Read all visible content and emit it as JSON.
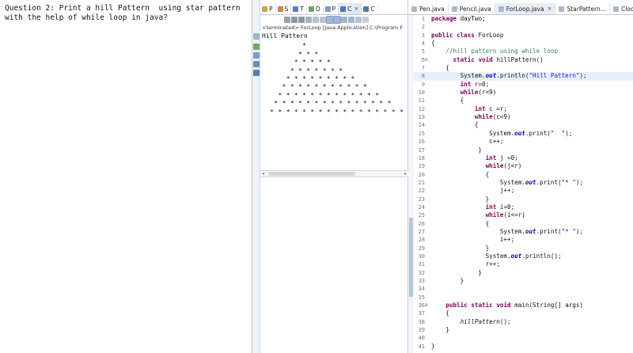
{
  "question": {
    "lines": [
      "Question 2: Print a hill Pattern  using star pattern",
      "with the help of while loop in java?"
    ]
  },
  "console": {
    "tabs": [
      {
        "label": "P",
        "icon": "problems-icon"
      },
      {
        "label": "S",
        "icon": "search-icon"
      },
      {
        "label": "T",
        "icon": "tasks-icon"
      },
      {
        "label": "D",
        "icon": "declaration-icon"
      },
      {
        "label": "P",
        "icon": "progress-icon"
      },
      {
        "label": "C",
        "icon": "console-icon",
        "active": true,
        "close": "×"
      },
      {
        "label": "C",
        "icon": "coverage-icon"
      }
    ],
    "status": "<terminated> ForLoop [Java Application] C:\\Program F",
    "output_title": "Hill Pattern",
    "output_rows": [
      "          * ",
      "         * * * ",
      "        * * * * * ",
      "       * * * * * * * ",
      "      * * * * * * * * * ",
      "     * * * * * * * * * * * ",
      "    * * * * * * * * * * * * * ",
      "   * * * * * * * * * * * * * * * ",
      "  * * * * * * * * * * * * * * * * * "
    ],
    "hscroll_left": "◂",
    "hscroll_right": "▸"
  },
  "editor": {
    "tabs": [
      {
        "label": "Pen.java"
      },
      {
        "label": "Pencil.java"
      },
      {
        "label": "ForLoop.java",
        "active": true,
        "close": "×"
      },
      {
        "label": "StarPattern..."
      },
      {
        "label": "Clock.ja"
      }
    ],
    "code_lines": [
      {
        "n": "1",
        "fold": "",
        "html": "<span class=\"kw\">package</span> dayTwo;"
      },
      {
        "n": "2",
        "fold": "",
        "html": ""
      },
      {
        "n": "3",
        "fold": "",
        "html": "<span class=\"kw\">public</span> <span class=\"kw\">class</span> ForLoop"
      },
      {
        "n": "4",
        "fold": "",
        "html": "{"
      },
      {
        "n": "5",
        "fold": "",
        "html": "    <span class=\"cm\">//hill pattern using while loop</span>"
      },
      {
        "n": "6",
        "fold": "⊖",
        "html": "      <span class=\"kw\">static</span> <span class=\"kw\">void</span> hillPattern()"
      },
      {
        "n": "7",
        "fold": "",
        "html": "    {"
      },
      {
        "n": "8",
        "fold": "",
        "html": "        System.<span class=\"fd\">out</span>.println(<span class=\"st\">\"Hill Pattern\"</span>);",
        "cur": true
      },
      {
        "n": "9",
        "fold": "",
        "html": "        <span class=\"kw\">int</span> r=0;"
      },
      {
        "n": "10",
        "fold": "",
        "html": "        <span class=\"kw\">while</span>(r&lt;9)"
      },
      {
        "n": "11",
        "fold": "",
        "html": "        {"
      },
      {
        "n": "12",
        "fold": "",
        "html": "            <span class=\"kw\">int</span> c =r;"
      },
      {
        "n": "13",
        "fold": "",
        "html": "            <span class=\"kw\">while</span>(c&lt;9)"
      },
      {
        "n": "14",
        "fold": "",
        "html": "            {"
      },
      {
        "n": "15",
        "fold": "",
        "html": "                System.<span class=\"fd\">out</span>.print(<span class=\"st\">\"  \"</span>);"
      },
      {
        "n": "16",
        "fold": "",
        "html": "                c++;"
      },
      {
        "n": "17",
        "fold": "",
        "html": "             }"
      },
      {
        "n": "18",
        "fold": "",
        "html": "               <span class=\"kw\">int</span> j =0;"
      },
      {
        "n": "19",
        "fold": "",
        "html": "               <span class=\"kw\">while</span>(j&lt;r)"
      },
      {
        "n": "20",
        "fold": "",
        "html": "               {"
      },
      {
        "n": "21",
        "fold": "",
        "html": "                   System.<span class=\"fd\">out</span>.print(<span class=\"st\">\"* \"</span>);"
      },
      {
        "n": "22",
        "fold": "",
        "html": "                   j++;"
      },
      {
        "n": "23",
        "fold": "",
        "html": "               }"
      },
      {
        "n": "24",
        "fold": "",
        "html": "               <span class=\"kw\">int</span> i=0;"
      },
      {
        "n": "25",
        "fold": "",
        "html": "               <span class=\"kw\">while</span>(i&lt;=r)"
      },
      {
        "n": "26",
        "fold": "",
        "html": "               {"
      },
      {
        "n": "27",
        "fold": "",
        "html": "                   System.<span class=\"fd\">out</span>.print(<span class=\"st\">\"* \"</span>);"
      },
      {
        "n": "28",
        "fold": "",
        "html": "                   i++;"
      },
      {
        "n": "29",
        "fold": "",
        "html": "               }"
      },
      {
        "n": "30",
        "fold": "",
        "html": "               System.<span class=\"fd\">out</span>.println();"
      },
      {
        "n": "31",
        "fold": "",
        "html": "               r++;"
      },
      {
        "n": "32",
        "fold": "",
        "html": "             }"
      },
      {
        "n": "33",
        "fold": "",
        "html": "        }"
      },
      {
        "n": "34",
        "fold": "",
        "html": ""
      },
      {
        "n": "35",
        "fold": "",
        "html": ""
      },
      {
        "n": "36",
        "fold": "⊖",
        "html": "    <span class=\"kw\">public</span> <span class=\"kw\">static</span> <span class=\"kw\">void</span> main(String[] args)"
      },
      {
        "n": "37",
        "fold": "",
        "html": "    {"
      },
      {
        "n": "38",
        "fold": "",
        "html": "        <span class=\"it\">hillPattern</span>();"
      },
      {
        "n": "39",
        "fold": "",
        "html": "    }"
      },
      {
        "n": "40",
        "fold": "",
        "html": ""
      },
      {
        "n": "41",
        "fold": "",
        "html": "}"
      }
    ]
  },
  "colors": {
    "keyword": "#7f0055",
    "comment": "#3f7f5f",
    "string": "#2a00ff",
    "field": "#0000c0",
    "current_line": "#e8f0fd"
  }
}
